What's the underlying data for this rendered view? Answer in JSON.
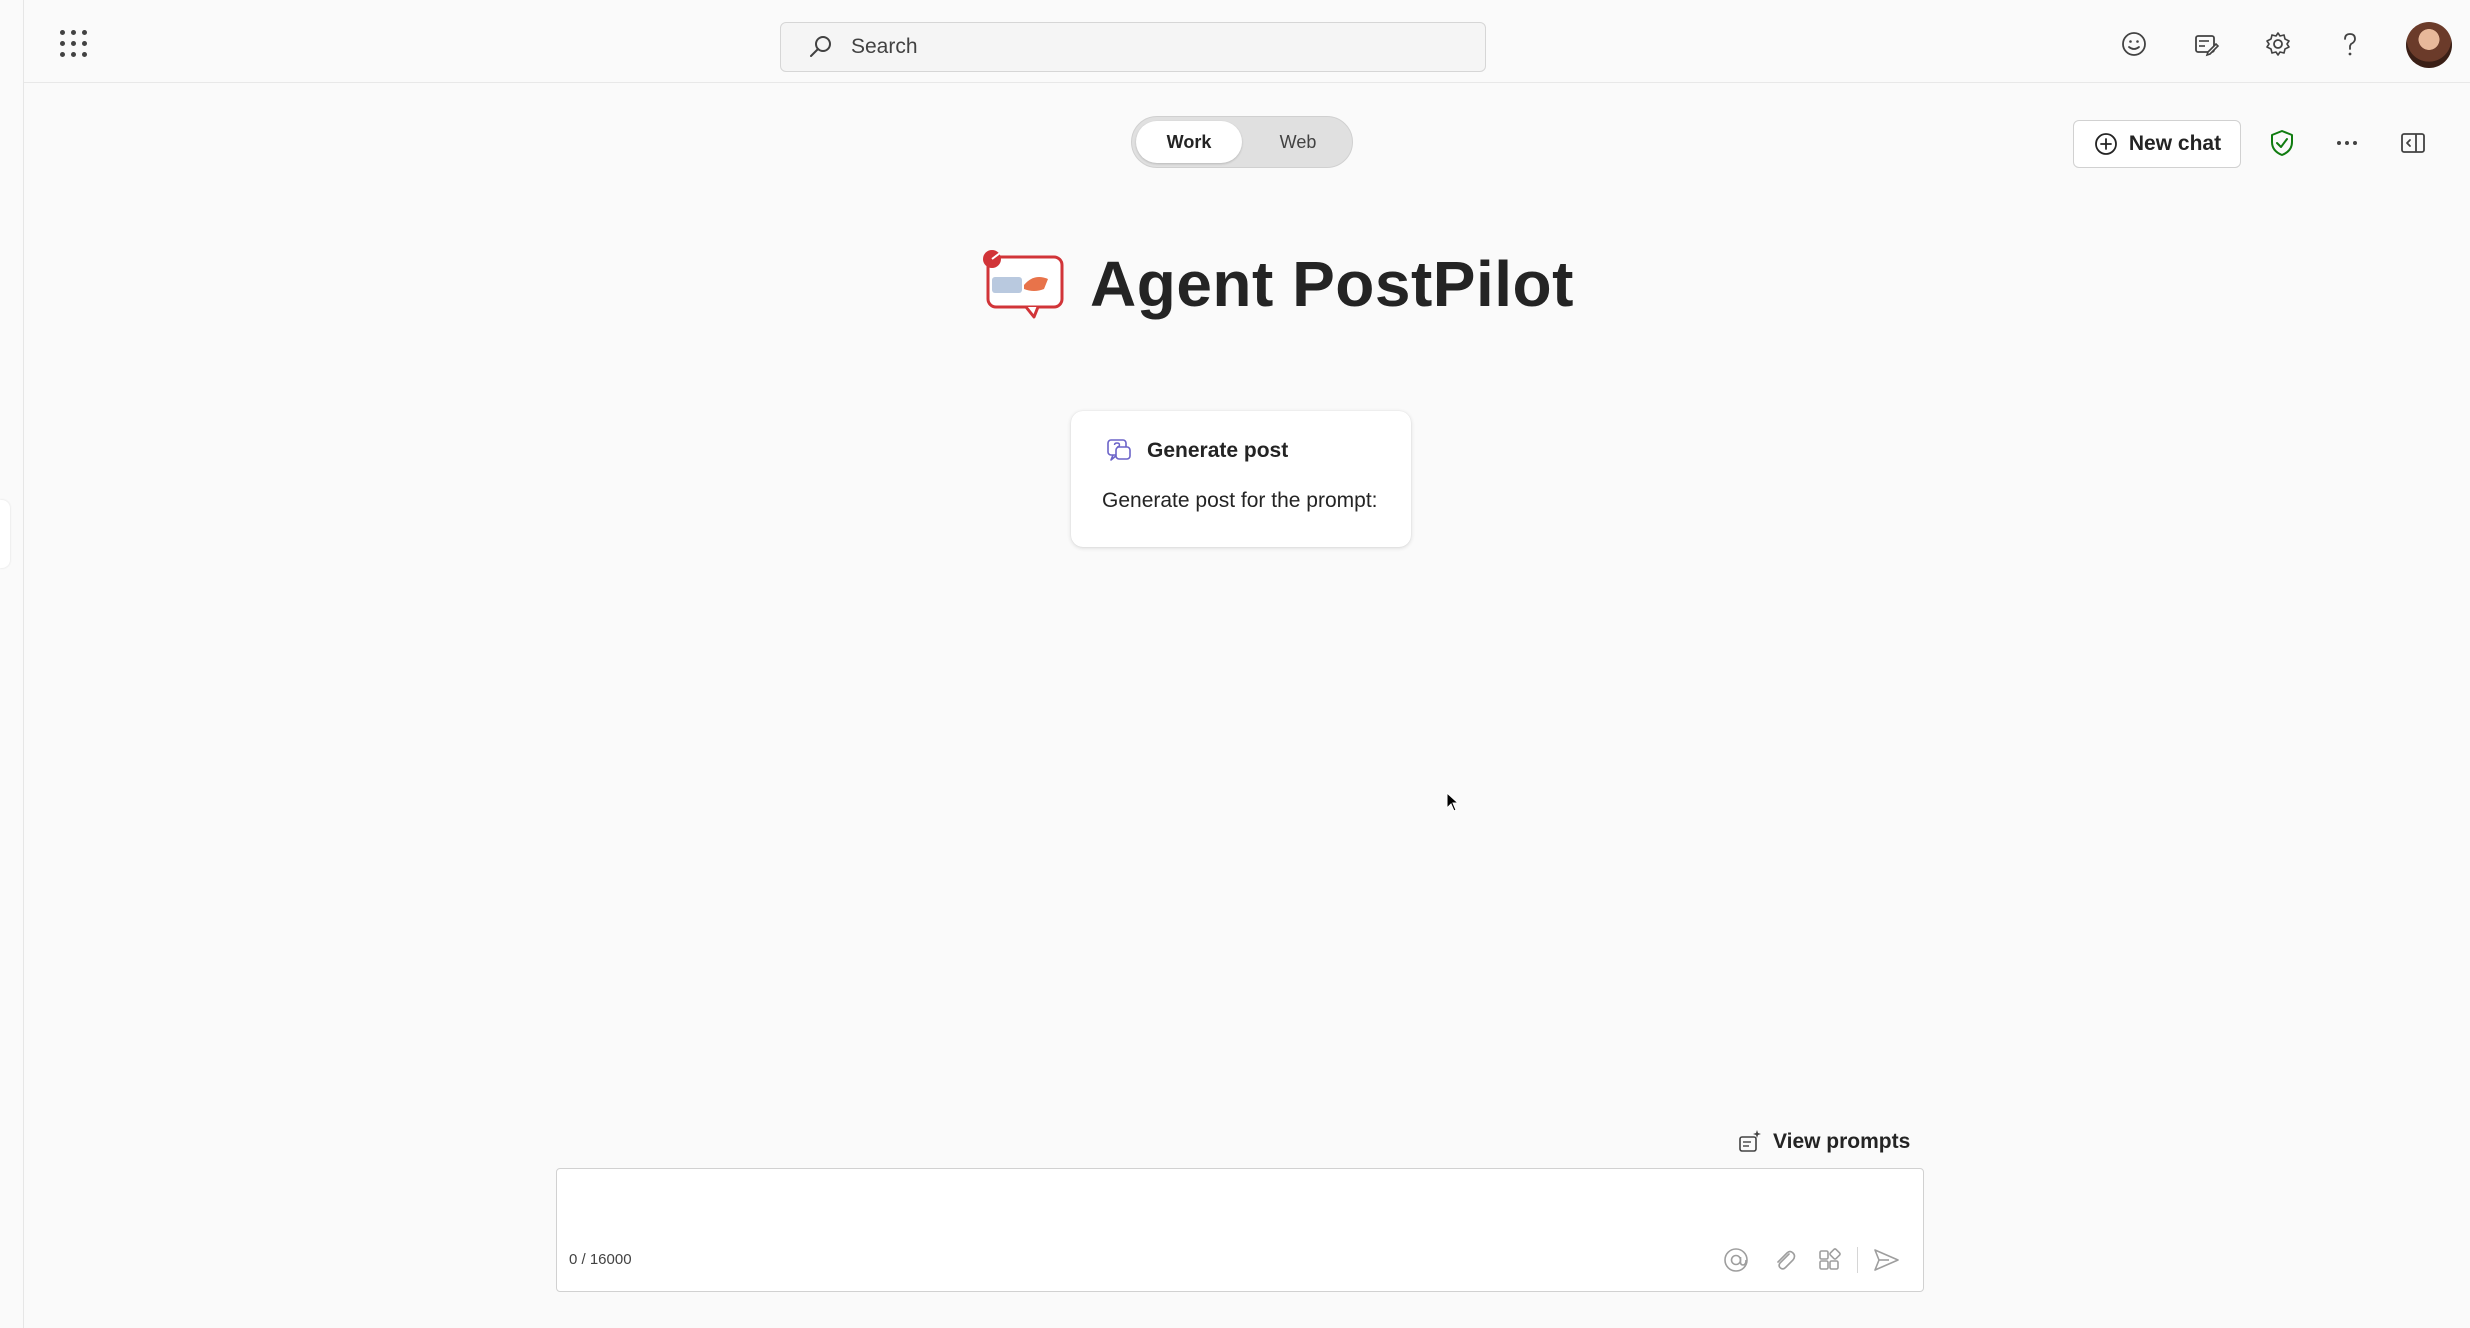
{
  "header": {
    "search_placeholder": "Search"
  },
  "mode_toggle": {
    "options": [
      "Work",
      "Web"
    ],
    "selected": "Work"
  },
  "actions": {
    "new_chat_label": "New chat"
  },
  "agent": {
    "name": "Agent PostPilot"
  },
  "prompt_card": {
    "title": "Generate post",
    "description": "Generate post for the prompt:"
  },
  "composer": {
    "view_prompts_label": "View prompts",
    "char_counter": "0 / 16000",
    "input_value": ""
  },
  "colors": {
    "shield_green": "#107c10",
    "logo_red": "#d13438"
  }
}
